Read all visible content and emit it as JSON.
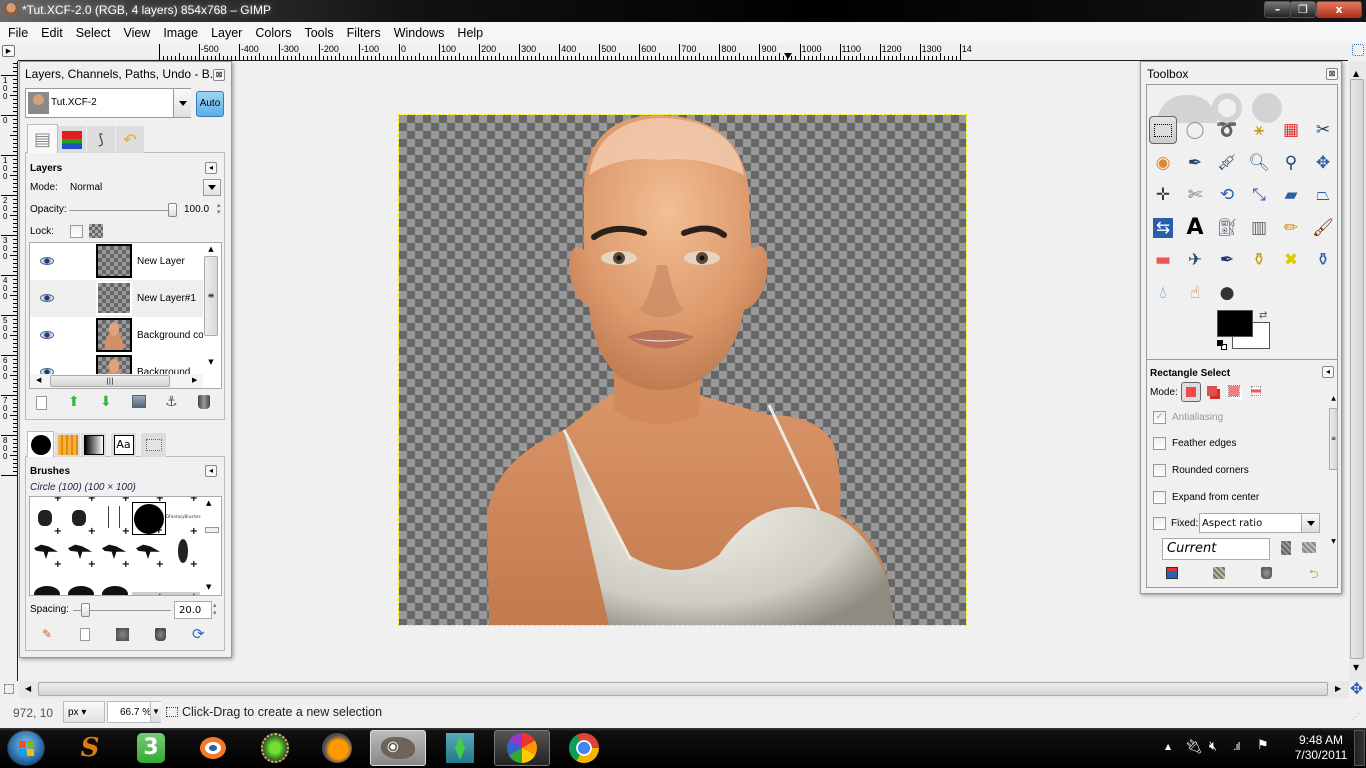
{
  "window": {
    "title": "*Tut.XCF-2.0 (RGB, 4 layers) 854x768 – GIMP",
    "minimize_label": "–",
    "restore_label": "❐",
    "close_label": "x"
  },
  "menu": [
    "File",
    "Edit",
    "Select",
    "View",
    "Image",
    "Layer",
    "Colors",
    "Tools",
    "Filters",
    "Windows",
    "Help"
  ],
  "rulers": {
    "horizontal": [
      "-500",
      "-400",
      "-300",
      "-200",
      "-100",
      "0",
      "100",
      "200",
      "300",
      "400",
      "500",
      "600",
      "700",
      "800",
      "900",
      "1000",
      "1100",
      "1200",
      "1300",
      "14"
    ],
    "vertical": [
      "100",
      "0",
      "100",
      "200",
      "300",
      "400",
      "500",
      "600",
      "700",
      "800"
    ]
  },
  "layers_dock": {
    "title": "Layers, Channels, Paths, Undo - B...",
    "image_selector": "Tut.XCF-2",
    "auto_label": "Auto",
    "tabs": [
      "layers",
      "channels",
      "paths",
      "undo"
    ],
    "layers_header": "Layers",
    "mode_label": "Mode:",
    "mode_value": "Normal",
    "opacity_label": "Opacity:",
    "opacity_value": "100.0",
    "opacity_fraction": 1.0,
    "lock_label": "Lock:",
    "layers": [
      {
        "name": "New Layer",
        "visible": true,
        "selected": false
      },
      {
        "name": "New Layer#1",
        "visible": true,
        "selected": true
      },
      {
        "name": "Background co",
        "visible": true,
        "selected": false
      },
      {
        "name": "Background",
        "visible": true,
        "selected": false
      }
    ],
    "layer_actions": [
      "new-layer",
      "raise-layer",
      "lower-layer",
      "duplicate-layer",
      "anchor-layer",
      "delete-layer"
    ]
  },
  "brushes_dock": {
    "tabs": [
      "brushes",
      "patterns",
      "gradients",
      "fonts",
      "images"
    ],
    "fonts_tab_label": "Aa",
    "header": "Brushes",
    "current_brush": "Circle (100) (100 × 100)",
    "spacing_label": "Spacing:",
    "spacing_value": "20.0",
    "spacing_fraction": 0.2,
    "brush_tag": "DFantasyBrushes"
  },
  "toolbox": {
    "title": "Toolbox",
    "tools": [
      "rect-select",
      "ellipse-select",
      "free-select",
      "fuzzy-select",
      "select-by-color",
      "scissors",
      "foreground-select",
      "paths",
      "color-picker",
      "zoom",
      "measure",
      "move",
      "align",
      "crop",
      "rotate",
      "scale",
      "shear",
      "perspective",
      "flip",
      "text",
      "bucket-fill",
      "blend",
      "pencil",
      "paintbrush",
      "eraser",
      "airbrush",
      "ink",
      "clone",
      "heal",
      "perspective-clone",
      "blur-sharpen",
      "smudge",
      "dodge-burn"
    ],
    "fg_color": "#000000",
    "bg_color": "#ffffff"
  },
  "tool_options": {
    "header": "Rectangle Select",
    "mode_label": "Mode:",
    "antialiasing_label": "Antialiasing",
    "antialiasing_checked": true,
    "feather_label": "Feather edges",
    "feather_checked": false,
    "rounded_label": "Rounded corners",
    "rounded_checked": false,
    "expand_label": "Expand from center",
    "expand_checked": false,
    "fixed_label": "Fixed:",
    "fixed_checked": false,
    "fixed_value": "Aspect ratio",
    "current_value": "Current"
  },
  "statusbar": {
    "coords": "972, 10",
    "unit": "px",
    "zoom": "66.7 %",
    "message": "Click-Drag to create a new selection"
  },
  "taskbar": {
    "apps": [
      "start",
      "sculptris",
      "app-3",
      "blender",
      "sims-launcher",
      "fl-studio",
      "gimp",
      "the-sims-3",
      "picasa",
      "chrome"
    ],
    "three_label": "3",
    "clock_time": "9:48 AM",
    "clock_date": "7/30/2011"
  },
  "colors": {
    "accent_blue": "#5aaee8",
    "selection_marching_ants": "#eeee00"
  }
}
